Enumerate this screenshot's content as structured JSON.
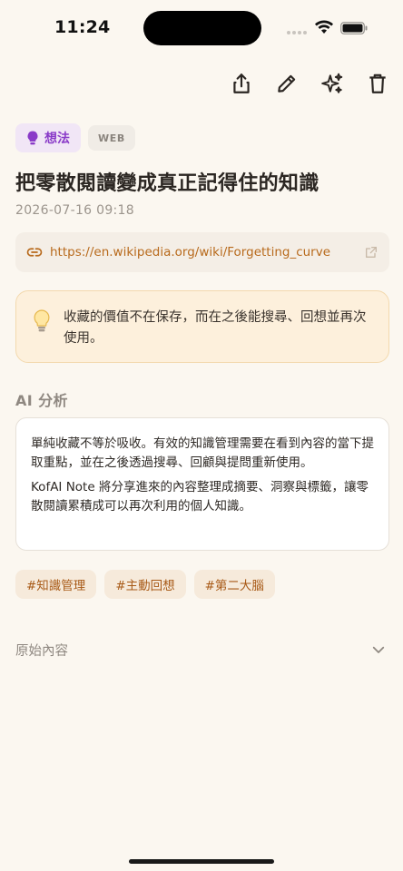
{
  "status_bar": {
    "time": "11:24"
  },
  "note": {
    "category": "想法",
    "source": "WEB",
    "title": "把零散閱讀變成真正記得住的知識",
    "date": "2026-07-16 09:18",
    "url": "https://en.wikipedia.org/wiki/Forgetting_curve",
    "insight": "收藏的價值不在保存，而在之後能搜尋、回想並再次使用。"
  },
  "ai_analysis": {
    "label": "AI 分析",
    "paragraphs": [
      "單純收藏不等於吸收。有效的知識管理需要在看到內容的當下提取重點，並在之後透過搜尋、回顧與提問重新使用。",
      "KofAI Note 將分享進來的內容整理成摘要、洞察與標籤，讓零散閱讀累積成可以再次利用的個人知識。"
    ]
  },
  "hashtags": [
    "#知識管理",
    "#主動回想",
    "#第二大腦"
  ],
  "raw_content": {
    "label": "原始內容"
  },
  "icons": {
    "share": "share-icon",
    "edit": "pencil-icon",
    "ai": "sparkles-icon",
    "delete": "trash-icon",
    "category": "lightbulb-icon",
    "link": "link-icon",
    "external": "external-link-icon",
    "insight": "lightbulb-icon",
    "expand": "chevron-down-icon"
  },
  "colors": {
    "background": "#FBF7F0",
    "accent": "#B86A1C",
    "category": "#8A3BC8",
    "insight_bg": "#FDF0DC"
  }
}
